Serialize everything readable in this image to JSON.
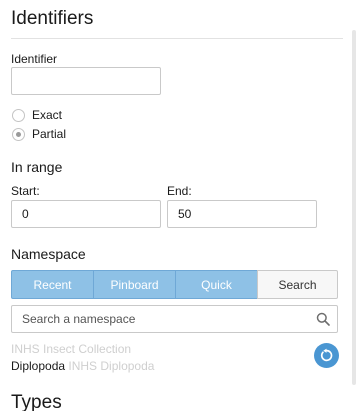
{
  "identifiers": {
    "title": "Identifiers",
    "identifier_label": "Identifier",
    "identifier_value": "",
    "match_options": [
      {
        "label": "Exact",
        "checked": false
      },
      {
        "label": "Partial",
        "checked": true
      }
    ]
  },
  "in_range": {
    "title": "In range",
    "start_label": "Start:",
    "start_value": "0",
    "end_label": "End:",
    "end_value": "50"
  },
  "namespace": {
    "title": "Namespace",
    "tabs": [
      {
        "label": "Recent",
        "active": true
      },
      {
        "label": "Pinboard",
        "active": true
      },
      {
        "label": "Quick",
        "active": true
      },
      {
        "label": "Search",
        "active": false
      }
    ],
    "search_placeholder": "Search a namespace",
    "search_icon": "search-icon",
    "recent_items": [
      {
        "short_name": "",
        "full_name": "INHS Insect Collection"
      },
      {
        "short_name": "Diplopoda",
        "full_name": "INHS Diplopoda"
      }
    ],
    "reset_icon": "reset-icon"
  },
  "types": {
    "title": "Types"
  },
  "colors": {
    "tab_active_bg": "#8ec1e6",
    "accent": "#4a96d2",
    "muted_text": "#cfcfcf"
  }
}
